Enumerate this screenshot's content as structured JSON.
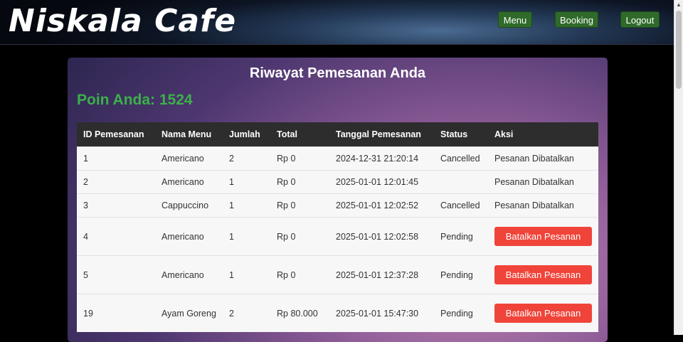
{
  "header": {
    "brand": "Niskala Cafe",
    "nav": [
      "Menu",
      "Booking",
      "Logout"
    ]
  },
  "page": {
    "title": "Riwayat Pemesanan Anda",
    "points": "Poin Anda: 1524"
  },
  "table": {
    "columns": [
      "ID Pemesanan",
      "Nama Menu",
      "Jumlah",
      "Total",
      "Tanggal Pemesanan",
      "Status",
      "Aksi"
    ],
    "rows": [
      {
        "id": "1",
        "menu": "Americano",
        "qty": "2",
        "total": "Rp 0",
        "date": "2024-12-31 21:20:14",
        "status": "Cancelled",
        "action": "Pesanan Dibatalkan"
      },
      {
        "id": "2",
        "menu": "Americano",
        "qty": "1",
        "total": "Rp 0",
        "date": "2025-01-01 12:01:45",
        "status": "",
        "action": "Pesanan Dibatalkan"
      },
      {
        "id": "3",
        "menu": "Cappuccino",
        "qty": "1",
        "total": "Rp 0",
        "date": "2025-01-01 12:02:52",
        "status": "Cancelled",
        "action": "Pesanan Dibatalkan"
      },
      {
        "id": "4",
        "menu": "Americano",
        "qty": "1",
        "total": "Rp 0",
        "date": "2025-01-01 12:02:58",
        "status": "Pending",
        "action": "Batalkan Pesanan"
      },
      {
        "id": "5",
        "menu": "Americano",
        "qty": "1",
        "total": "Rp 0",
        "date": "2025-01-01 12:37:28",
        "status": "Pending",
        "action": "Batalkan Pesanan"
      },
      {
        "id": "19",
        "menu": "Ayam Goreng",
        "qty": "2",
        "total": "Rp 80.000",
        "date": "2025-01-01 15:47:30",
        "status": "Pending",
        "action": "Batalkan Pesanan"
      }
    ]
  },
  "colors": {
    "accent_green": "#3cb04a",
    "nav_green": "#2f6a2a",
    "cancel_red": "#f0443a"
  }
}
